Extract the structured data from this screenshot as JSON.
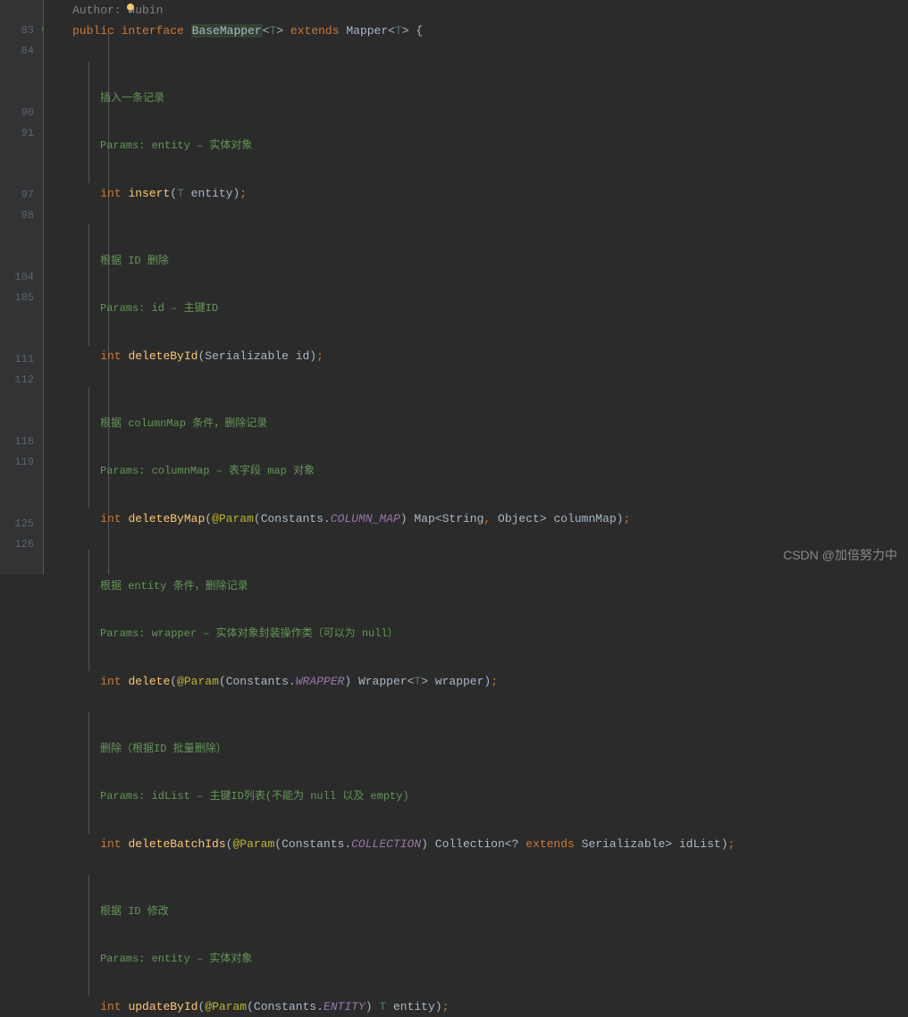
{
  "gutter": {
    "lines": [
      "83",
      "84",
      "",
      "",
      "90",
      "91",
      "",
      "",
      "97",
      "98",
      "",
      "",
      "104",
      "105",
      "",
      "",
      "111",
      "112",
      "",
      "",
      "118",
      "119",
      "",
      "",
      "125",
      "126"
    ]
  },
  "topline": {
    "author_text": "Author: hubin"
  },
  "decl": {
    "public": "public",
    "interface": "interface",
    "name": "BaseMapper",
    "lt": "<",
    "T": "T",
    "gt": ">",
    "extends": "extends",
    "mapper": "Mapper",
    "lt2": "<",
    "T2": "T",
    "gt2": ">",
    "brace": " {"
  },
  "docs": {
    "insert_title": "插入一条记录",
    "insert_params": "Params: entity – 实体对象",
    "deleteById_title": "根据 ID 删除",
    "deleteById_params": "Params: id – 主键ID",
    "deleteByMap_title": "根据 columnMap 条件，删除记录",
    "deleteByMap_params": "Params: columnMap – 表字段 map 对象",
    "delete_title": "根据 entity 条件，删除记录",
    "delete_params": "Params: wrapper – 实体对象封装操作类（可以为 null）",
    "deleteBatch_title": "删除（根据ID 批量删除）",
    "deleteBatch_params": "Params: idList – 主键ID列表(不能为 null 以及 empty)",
    "updateById_title": "根据 ID 修改",
    "updateById_params": "Params: entity – 实体对象"
  },
  "methods": {
    "int": "int",
    "insert": {
      "name": "insert",
      "open": "(",
      "T": "T",
      "p": " entity",
      "close": ")",
      "semi": ";"
    },
    "deleteById": {
      "name": "deleteById",
      "open": "(",
      "type": "Serializable",
      "p": " id",
      "close": ")",
      "semi": ";"
    },
    "deleteByMap": {
      "name": "deleteByMap",
      "open": "(",
      "anno": "@Param",
      "ao": "(",
      "const": "Constants",
      "dot": ".",
      "field": "COLUMN_MAP",
      "ac": ")",
      "sp": " ",
      "map": "Map",
      "lt": "<",
      "str": "String",
      "comma": ",",
      "sp2": " ",
      "obj": "Object",
      "gt": ">",
      "p": " columnMap",
      "close": ")",
      "semi": ";"
    },
    "delete": {
      "name": "delete",
      "open": "(",
      "anno": "@Param",
      "ao": "(",
      "const": "Constants",
      "dot": ".",
      "field": "WRAPPER",
      "ac": ")",
      "sp": " ",
      "wrap": "Wrapper",
      "lt": "<",
      "T": "T",
      "gt": ">",
      "p": " wrapper",
      "close": ")",
      "semi": ";"
    },
    "deleteBatchIds": {
      "name": "deleteBatchIds",
      "open": "(",
      "anno": "@Param",
      "ao": "(",
      "const": "Constants",
      "dot": ".",
      "field": "COLLECTION",
      "ac": ")",
      "sp": " ",
      "coll": "Collection",
      "lt": "<",
      "q": "?",
      "sp2": " ",
      "ext": "extends",
      "sp3": " ",
      "ser": "Serializable",
      "gt": ">",
      "p": " idList",
      "close": ")",
      "semi": ";"
    },
    "updateById": {
      "name": "updateById",
      "open": "(",
      "anno": "@Param",
      "ao": "(",
      "const": "Constants",
      "dot": ".",
      "field": "ENTITY",
      "ac": ")",
      "sp": " ",
      "T": "T",
      "p": " entity",
      "close": ")",
      "semi": ";"
    }
  },
  "watermark": "CSDN @加倍努力中"
}
